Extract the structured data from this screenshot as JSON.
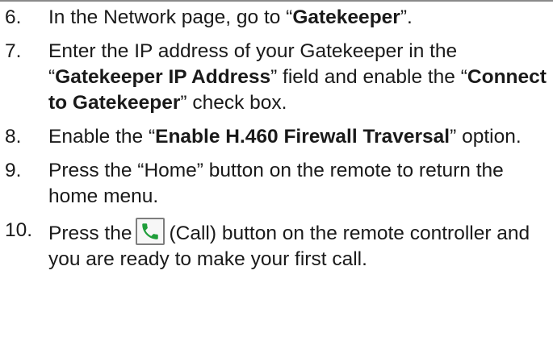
{
  "steps": [
    {
      "number": "6.",
      "parts": [
        "In the Network page, go to “",
        "Gatekeeper",
        "”."
      ]
    },
    {
      "number": "7.",
      "parts": [
        "Enter the IP address of your Gatekeeper in the “",
        "Gatekeeper IP Address",
        "” field and enable the “",
        "Connect to Gatekeeper",
        "” check box."
      ]
    },
    {
      "number": "8.",
      "parts": [
        "Enable the “",
        "Enable H.460 Firewall Traversal",
        "” option."
      ]
    },
    {
      "number": "9.",
      "text": "Press the “Home” button on the remote to return the home menu."
    },
    {
      "number": "10.",
      "before_icon": "Press the",
      "after_icon": "(Call) button on the remote controller and you are ready to make your first call."
    }
  ],
  "icons": {
    "call": "phone-handset-icon",
    "call_color": "#1f9e3a"
  }
}
